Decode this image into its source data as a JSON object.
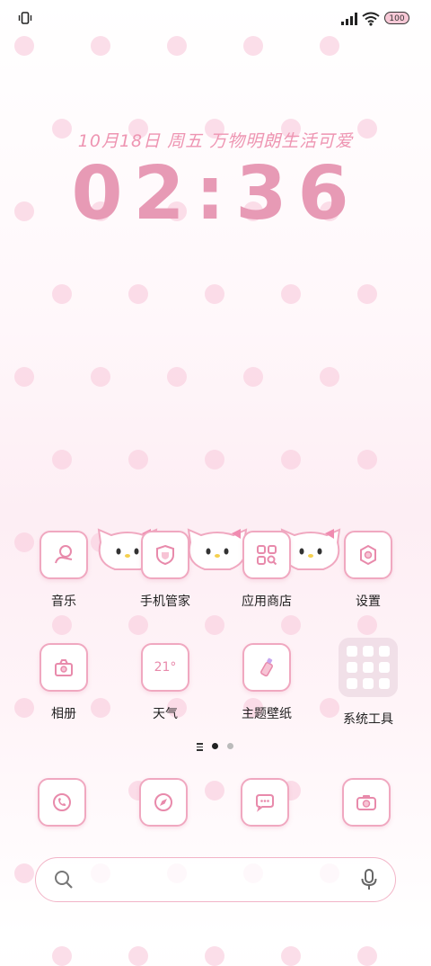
{
  "status_bar": {
    "battery": "100"
  },
  "clock_widget": {
    "date_line": "10月18日 周五 万物明朗生活可爱",
    "time": "02:36"
  },
  "apps_row1": [
    {
      "label": "音乐"
    },
    {
      "label": "手机管家"
    },
    {
      "label": "应用商店"
    },
    {
      "label": "设置"
    }
  ],
  "apps_row2": [
    {
      "label": "相册"
    },
    {
      "label": "天气",
      "tile_text": "21°"
    },
    {
      "label": "主题壁纸"
    },
    {
      "label": "系统工具"
    }
  ],
  "dock": [
    {
      "icon": "phone-icon"
    },
    {
      "icon": "browser-icon"
    },
    {
      "icon": "message-icon"
    },
    {
      "icon": "camera-icon"
    }
  ],
  "pager": {
    "pages": 2,
    "current": 1
  },
  "colors": {
    "accent": "#e79ab5",
    "tile_border": "#f0a8c0",
    "dot": "#f9d3e2"
  },
  "search_bar": {
    "left_icon": "search-icon",
    "right_icon": "mic-icon"
  }
}
